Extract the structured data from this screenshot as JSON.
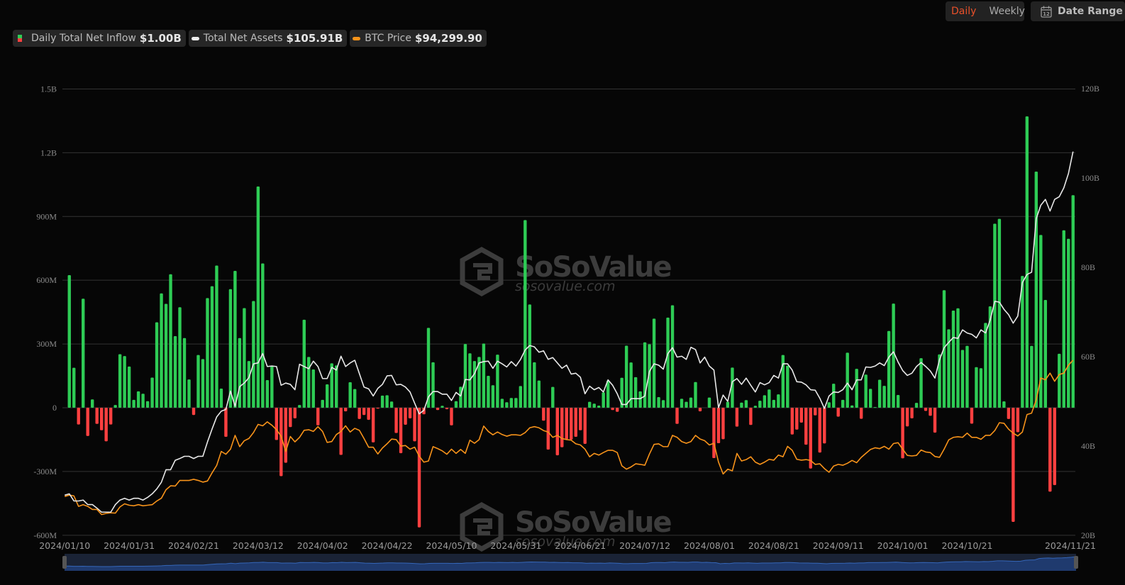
{
  "controls": {
    "period_options": [
      "Daily",
      "Weekly"
    ],
    "period_selected": "Daily",
    "date_range_label": "Date Range",
    "calendar_day": "12"
  },
  "legend": [
    {
      "label": "Daily Total Net Inflow",
      "value": "$1.00B"
    },
    {
      "label": "Total Net Assets",
      "value": "$105.91B"
    },
    {
      "label": "BTC Price",
      "value": "$94,299.90"
    }
  ],
  "watermark": {
    "brand": "SoSoValue",
    "url": "sosovalue.com"
  },
  "colors": {
    "inflow_pos": "#2ecc55",
    "inflow_neg": "#ff4040",
    "assets": "#e8e8e8",
    "btc": "#f7931a",
    "accent": "#e8502a"
  },
  "chart_data": {
    "type": "bar+line",
    "title": "",
    "x_tick_labels": [
      {
        "i": 0,
        "label": "2024/01/10"
      },
      {
        "i": 14,
        "label": "2024/01/31"
      },
      {
        "i": 28,
        "label": "2024/02/21"
      },
      {
        "i": 42,
        "label": "2024/03/12"
      },
      {
        "i": 56,
        "label": "2024/04/02"
      },
      {
        "i": 70,
        "label": "2024/04/22"
      },
      {
        "i": 84,
        "label": "2024/05/10"
      },
      {
        "i": 98,
        "label": "2024/05/31"
      },
      {
        "i": 112,
        "label": "2024/06/21"
      },
      {
        "i": 126,
        "label": "2024/07/12"
      },
      {
        "i": 140,
        "label": "2024/08/01"
      },
      {
        "i": 154,
        "label": "2024/08/21"
      },
      {
        "i": 168,
        "label": "2024/09/11"
      },
      {
        "i": 182,
        "label": "2024/10/01"
      },
      {
        "i": 196,
        "label": "2024/10/21"
      },
      {
        "i": 219,
        "label": "2024/11/21"
      }
    ],
    "left_axis": {
      "unit": "USD M",
      "range": [
        -600,
        1500
      ],
      "ticks": [
        {
          "v": 1500,
          "label": "1.5B"
        },
        {
          "v": 1200,
          "label": "1.2B"
        },
        {
          "v": 900,
          "label": "900M"
        },
        {
          "v": 600,
          "label": "600M"
        },
        {
          "v": 300,
          "label": "300M"
        },
        {
          "v": 0,
          "label": "0"
        },
        {
          "v": -300,
          "label": "-300M"
        },
        {
          "v": -600,
          "label": "-600M"
        }
      ]
    },
    "right_axis": {
      "unit": "USD B",
      "range": [
        20,
        120
      ],
      "ticks": [
        {
          "v": 120,
          "label": "120B"
        },
        {
          "v": 100,
          "label": "100B"
        },
        {
          "v": 80,
          "label": "80B"
        },
        {
          "v": 60,
          "label": "60B"
        },
        {
          "v": 40,
          "label": "40B"
        },
        {
          "v": 20,
          "label": "20B"
        }
      ]
    },
    "btc_axis_range_k": [
      32.1,
      190.7
    ],
    "grid": true,
    "series": [
      {
        "name": "Daily Total Net Inflow",
        "type": "bar",
        "unit": "USD M",
        "values": [
          0,
          624,
          188,
          -79,
          513,
          -133,
          39,
          -76,
          -106,
          -158,
          -79,
          13,
          252,
          243,
          194,
          37,
          77,
          66,
          31,
          142,
          402,
          538,
          489,
          628,
          337,
          473,
          328,
          133,
          -34,
          248,
          229,
          516,
          572,
          669,
          90,
          -137,
          558,
          644,
          328,
          469,
          220,
          502,
          1041,
          679,
          130,
          198,
          -152,
          -322,
          -259,
          -91,
          -50,
          13,
          414,
          239,
          180,
          -83,
          37,
          110,
          209,
          199,
          -222,
          -17,
          120,
          88,
          -53,
          -34,
          -57,
          -163,
          -4,
          57,
          59,
          29,
          -119,
          -214,
          -80,
          -50,
          -158,
          -563,
          -31,
          376,
          214,
          -11,
          9,
          -7,
          -83,
          31,
          99,
          300,
          256,
          220,
          239,
          302,
          150,
          106,
          250,
          42,
          26,
          46,
          46,
          102,
          883,
          486,
          214,
          128,
          -61,
          -197,
          98,
          -224,
          -186,
          -148,
          -150,
          -137,
          -106,
          -170,
          28,
          19,
          10,
          72,
          128,
          -11,
          -19,
          141,
          292,
          213,
          144,
          77,
          308,
          299,
          419,
          50,
          36,
          424,
          482,
          -76,
          42,
          28,
          48,
          121,
          -17,
          0,
          48,
          -237,
          -167,
          -148,
          28,
          189,
          -89,
          24,
          36,
          -81,
          9,
          33,
          59,
          86,
          37,
          63,
          248,
          198,
          -126,
          -103,
          -70,
          -174,
          -286,
          -36,
          -211,
          -168,
          26,
          113,
          -42,
          37,
          259,
          11,
          183,
          -52,
          156,
          89,
          3,
          132,
          103,
          361,
          490,
          60,
          -238,
          -88,
          -50,
          23,
          233,
          -15,
          -38,
          -117,
          251,
          553,
          369,
          457,
          468,
          272,
          291,
          -75,
          191,
          186,
          399,
          477,
          866,
          889,
          30,
          -53,
          -537,
          -115,
          620,
          1371,
          291,
          1111,
          813,
          507,
          -395,
          -364,
          254,
          835,
          795,
          1000
        ]
      },
      {
        "name": "Total Net Assets",
        "type": "line",
        "unit": "USD B",
        "axis": "right",
        "values": [
          29.0,
          29.3,
          27.7,
          27.7,
          27.9,
          26.9,
          26.9,
          26.1,
          25.2,
          25.2,
          25.2,
          26.9,
          27.9,
          28.3,
          27.9,
          28.3,
          28.3,
          27.9,
          28.5,
          29.3,
          30.4,
          31.9,
          34.7,
          34.7,
          36.8,
          37.2,
          37.7,
          37.7,
          37.2,
          37.7,
          37.7,
          40.9,
          43.8,
          46.5,
          47.8,
          48.2,
          52.3,
          48.9,
          53.3,
          54.1,
          55.3,
          58.4,
          58.6,
          60.7,
          57.8,
          57.9,
          57.8,
          53.6,
          54.1,
          53.8,
          52.6,
          58.3,
          57.8,
          57.3,
          59.0,
          57.8,
          55.1,
          55.1,
          57.6,
          57.0,
          60.1,
          57.8,
          58.6,
          59.2,
          56.2,
          53.2,
          52.8,
          51.2,
          52.9,
          53.8,
          55.7,
          55.8,
          53.7,
          53.8,
          53.2,
          52.1,
          49.6,
          47.2,
          48.0,
          51.0,
          52.2,
          52.2,
          51.6,
          51.6,
          50.2,
          52.0,
          51.2,
          54.9,
          54.8,
          56.2,
          58.6,
          58.9,
          59.0,
          57.4,
          59.0,
          58.4,
          57.7,
          58.9,
          57.9,
          59.4,
          61.5,
          62.5,
          62.2,
          61.0,
          61.3,
          59.4,
          59.8,
          58.6,
          57.4,
          58.1,
          56.1,
          56.3,
          55.4,
          51.7,
          53.4,
          52.6,
          53.1,
          52.1,
          54.8,
          53.6,
          51.7,
          49.3,
          49.3,
          50.6,
          50.6,
          50.6,
          51.2,
          56.7,
          58.4,
          58.1,
          57.2,
          60.7,
          62.0,
          59.9,
          60.1,
          59.4,
          62.1,
          61.6,
          58.6,
          59.9,
          57.9,
          57.0,
          48.6,
          51.4,
          50.0,
          54.4,
          55.1,
          53.8,
          55.2,
          53.6,
          52.1,
          54.2,
          53.7,
          54.2,
          55.8,
          55.2,
          58.4,
          58.4,
          57.0,
          54.4,
          54.3,
          53.7,
          52.6,
          52.5,
          50.7,
          48.4,
          51.2,
          52.1,
          52.0,
          52.6,
          54.1,
          52.6,
          54.8,
          54.8,
          57.7,
          57.6,
          57.9,
          58.6,
          58.0,
          59.9,
          61.1,
          58.8,
          56.9,
          55.8,
          56.3,
          57.8,
          58.7,
          57.8,
          56.8,
          55.2,
          59.3,
          62.0,
          63.2,
          64.3,
          64.1,
          66.0,
          65.3,
          65.0,
          64.2,
          66.0,
          65.3,
          68.2,
          72.4,
          72.2,
          70.6,
          69.4,
          67.5,
          69.1,
          76.6,
          78.4,
          78.9,
          90.9,
          93.9,
          95.2,
          92.6,
          95.2,
          95.8,
          97.8,
          101.0,
          105.91
        ]
      },
      {
        "name": "BTC Price",
        "type": "line",
        "unit": "USD K",
        "axis": "hidden",
        "values": [
          45.9,
          46.4,
          46.1,
          42.4,
          43.0,
          42.4,
          41.3,
          41.3,
          39.5,
          39.9,
          40.1,
          40.0,
          42.2,
          43.3,
          42.8,
          42.6,
          43.0,
          42.6,
          42.8,
          43.0,
          44.3,
          45.3,
          48.3,
          49.7,
          49.6,
          51.6,
          51.6,
          51.6,
          52.0,
          51.6,
          51.0,
          51.4,
          54.3,
          56.9,
          61.9,
          60.9,
          62.7,
          67.6,
          63.6,
          65.7,
          66.5,
          68.6,
          71.5,
          71.0,
          72.4,
          71.2,
          69.6,
          67.3,
          61.9,
          67.2,
          65.3,
          66.9,
          69.4,
          69.6,
          69.0,
          70.7,
          69.0,
          65.1,
          65.4,
          67.9,
          69.0,
          71.0,
          68.8,
          70.1,
          69.4,
          66.5,
          63.4,
          63.4,
          61.0,
          63.1,
          64.6,
          66.3,
          66.1,
          63.8,
          64.0,
          62.7,
          63.4,
          60.2,
          58.1,
          58.5,
          63.6,
          62.9,
          62.1,
          60.9,
          62.7,
          61.2,
          62.6,
          61.2,
          65.9,
          64.8,
          66.1,
          70.9,
          69.0,
          67.8,
          68.8,
          67.9,
          67.3,
          67.8,
          67.8,
          67.6,
          68.6,
          70.3,
          70.7,
          70.3,
          69.3,
          68.8,
          66.9,
          67.6,
          66.5,
          66.1,
          65.9,
          64.6,
          64.2,
          62.7,
          60.0,
          61.2,
          60.6,
          61.5,
          62.3,
          62.3,
          61.5,
          56.8,
          55.6,
          56.4,
          57.5,
          57.3,
          57.0,
          61.0,
          64.4,
          64.6,
          63.6,
          63.6,
          67.6,
          66.9,
          65.4,
          64.8,
          65.4,
          67.6,
          66.3,
          65.7,
          64.2,
          64.8,
          58.1,
          53.9,
          55.6,
          55.0,
          61.2,
          58.5,
          59.0,
          60.0,
          58.1,
          57.3,
          58.1,
          59.1,
          58.8,
          60.6,
          60.0,
          63.7,
          62.3,
          59.1,
          58.8,
          59.0,
          58.7,
          57.3,
          57.5,
          55.8,
          54.5,
          56.7,
          57.3,
          57.0,
          57.7,
          58.7,
          57.9,
          59.8,
          61.2,
          62.6,
          63.2,
          62.9,
          63.7,
          62.7,
          64.7,
          65.0,
          62.7,
          60.5,
          60.3,
          60.5,
          62.4,
          61.7,
          61.5,
          60.1,
          59.8,
          62.7,
          66.0,
          66.9,
          67.1,
          66.9,
          68.4,
          66.9,
          66.9,
          66.2,
          67.6,
          67.6,
          69.3,
          72.1,
          71.9,
          69.8,
          68.4,
          67.4,
          68.8,
          75.0,
          75.5,
          80.2,
          88.0,
          87.3,
          89.7,
          86.8,
          89.2,
          89.7,
          92.5,
          94.2999
        ]
      }
    ]
  }
}
